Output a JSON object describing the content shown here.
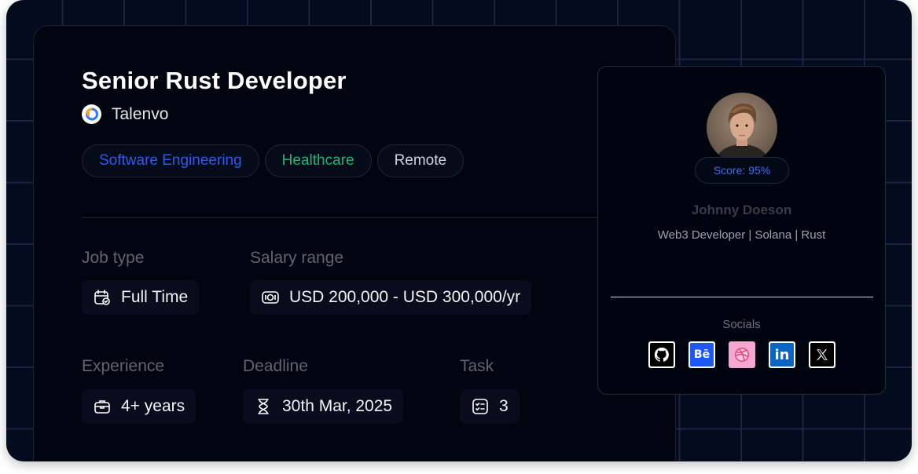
{
  "job": {
    "title": "Senior Rust Developer",
    "company": "Talenvo",
    "company_logo_icon": "talenvo-logo-icon",
    "tags": [
      {
        "label": "Software Engineering",
        "color": "#2f5bea"
      },
      {
        "label": "Healthcare",
        "color": "#22b573"
      },
      {
        "label": "Remote",
        "color": "#d1d5db"
      }
    ],
    "details": {
      "job_type": {
        "label": "Job type",
        "value": "Full Time",
        "icon": "calendar-check-icon"
      },
      "salary": {
        "label": "Salary range",
        "value": "USD 200,000 - USD 300,000/yr",
        "icon": "money-icon"
      },
      "experience": {
        "label": "Experience",
        "value": "4+ years",
        "icon": "briefcase-icon"
      },
      "deadline": {
        "label": "Deadline",
        "value": "30th Mar, 2025",
        "icon": "hourglass-icon"
      },
      "task": {
        "label": "Task",
        "value": "3",
        "icon": "checklist-icon"
      }
    }
  },
  "profile": {
    "score": "Score: 95%",
    "name": "Johnny Doeson",
    "role": "Web3 Developer | Solana | Rust",
    "socials_label": "Socials",
    "socials": [
      "github-icon",
      "behance-icon",
      "dribbble-icon",
      "linkedin-icon",
      "x-icon"
    ],
    "accent_color": "#3b6ff5"
  }
}
